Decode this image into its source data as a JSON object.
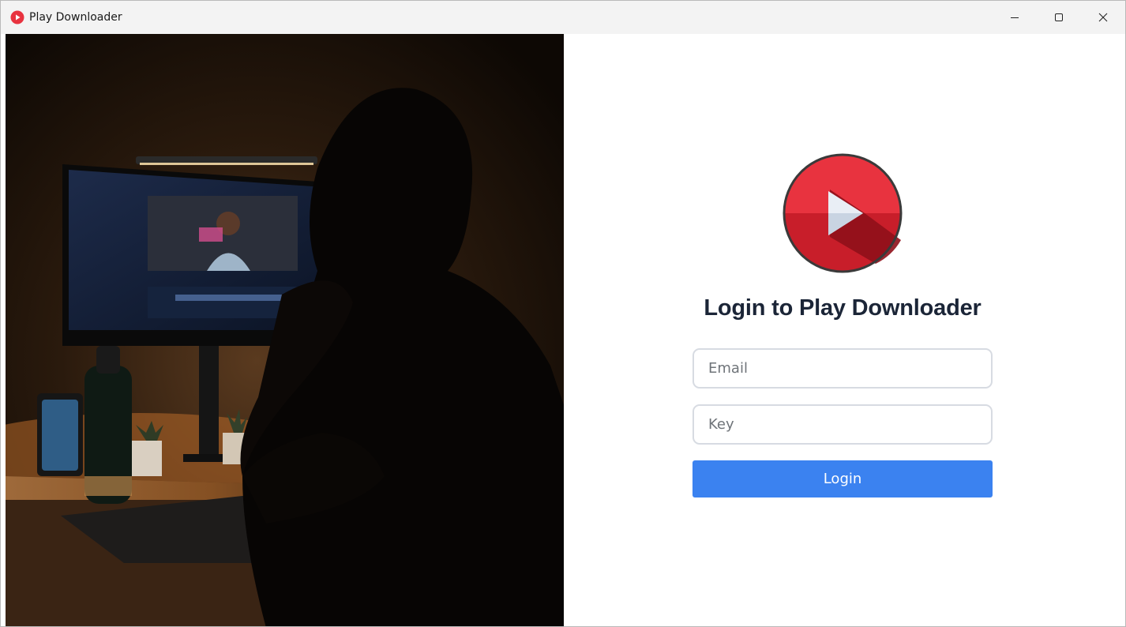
{
  "window": {
    "title": "Play Downloader",
    "icon": "play-logo-icon"
  },
  "controls": {
    "minimize_icon": "minimize-icon",
    "maximize_icon": "maximize-icon",
    "close_icon": "close-icon"
  },
  "login": {
    "heading": "Login to Play Downloader",
    "email_placeholder": "Email",
    "key_placeholder": "Key",
    "button_label": "Login"
  },
  "colors": {
    "brand_red": "#e8333f",
    "button_blue": "#3b82f0",
    "heading": "#1b2537"
  }
}
